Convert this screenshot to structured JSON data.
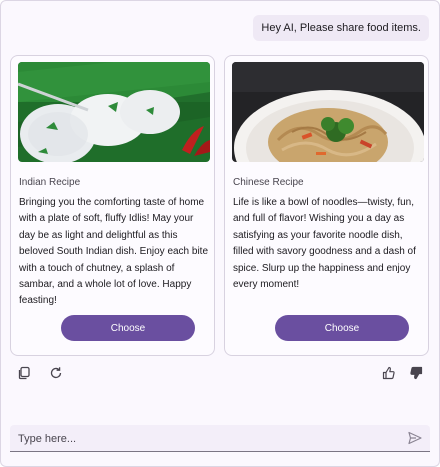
{
  "chat": {
    "user_message": "Hey AI, Please share food items."
  },
  "cards": [
    {
      "label": "Indian Recipe",
      "description": "Bringing you the comforting taste of home with a plate of soft, fluffy Idlis! May your day be as light and delightful as this beloved South Indian dish. Enjoy each bite with a touch of chutney, a splash of sambar, and a whole lot of love. Happy feasting!",
      "button": "Choose",
      "image_icon": "idli-image"
    },
    {
      "label": "Chinese Recipe",
      "description": "Life is like a bowl of noodles—twisty, fun, and full of flavor! Wishing you a day as satisfying as your favorite noodle dish, filled with savory goodness and a dash of spice. Slurp up the happiness and enjoy every moment!",
      "button": "Choose",
      "image_icon": "noodles-image"
    }
  ],
  "toolbar": {
    "copy_icon": "copy-icon",
    "regenerate_icon": "refresh-icon",
    "like_icon": "thumbs-up-icon",
    "dislike_icon": "thumbs-down-icon"
  },
  "composer": {
    "placeholder": "Type here...",
    "send_icon": "send-icon"
  },
  "colors": {
    "accent": "#6a4fa0",
    "background": "#fbf8fe",
    "bubble": "#efe9f5"
  }
}
